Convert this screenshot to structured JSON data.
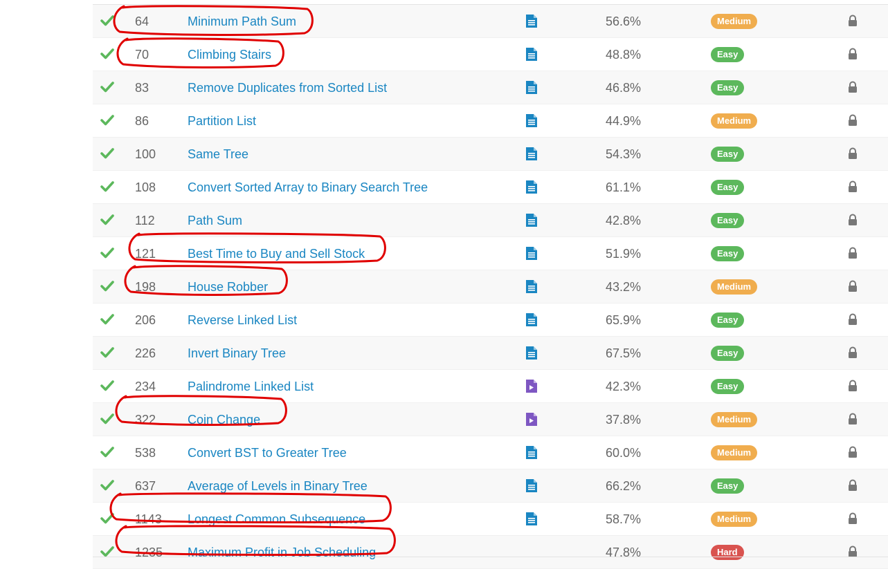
{
  "colors": {
    "title_link": "#1a86c2",
    "check": "#5cb85c",
    "easy": "#5cb85c",
    "medium": "#f0ad4e",
    "hard": "#d9534f",
    "solution_article": "#1a86c2",
    "solution_video": "#7e57c2",
    "annotation": "#e00000"
  },
  "icons": {
    "status": "check-icon",
    "solution_article": "document-icon",
    "solution_video": "video-document-icon",
    "premium": "lock-icon"
  },
  "problems": [
    {
      "id": "64",
      "title": "Minimum Path Sum",
      "solution": "article",
      "acceptance": "56.6%",
      "difficulty": "Medium",
      "circled": true
    },
    {
      "id": "70",
      "title": "Climbing Stairs",
      "solution": "article",
      "acceptance": "48.8%",
      "difficulty": "Easy",
      "circled": true
    },
    {
      "id": "83",
      "title": "Remove Duplicates from Sorted List",
      "solution": "article",
      "acceptance": "46.8%",
      "difficulty": "Easy",
      "circled": false
    },
    {
      "id": "86",
      "title": "Partition List",
      "solution": "article",
      "acceptance": "44.9%",
      "difficulty": "Medium",
      "circled": false
    },
    {
      "id": "100",
      "title": "Same Tree",
      "solution": "article",
      "acceptance": "54.3%",
      "difficulty": "Easy",
      "circled": false
    },
    {
      "id": "108",
      "title": "Convert Sorted Array to Binary Search Tree",
      "solution": "article",
      "acceptance": "61.1%",
      "difficulty": "Easy",
      "circled": false
    },
    {
      "id": "112",
      "title": "Path Sum",
      "solution": "article",
      "acceptance": "42.8%",
      "difficulty": "Easy",
      "circled": false
    },
    {
      "id": "121",
      "title": "Best Time to Buy and Sell Stock",
      "solution": "article",
      "acceptance": "51.9%",
      "difficulty": "Easy",
      "circled": true
    },
    {
      "id": "198",
      "title": "House Robber",
      "solution": "article",
      "acceptance": "43.2%",
      "difficulty": "Medium",
      "circled": true
    },
    {
      "id": "206",
      "title": "Reverse Linked List",
      "solution": "article",
      "acceptance": "65.9%",
      "difficulty": "Easy",
      "circled": false
    },
    {
      "id": "226",
      "title": "Invert Binary Tree",
      "solution": "article",
      "acceptance": "67.5%",
      "difficulty": "Easy",
      "circled": false
    },
    {
      "id": "234",
      "title": "Palindrome Linked List",
      "solution": "video",
      "acceptance": "42.3%",
      "difficulty": "Easy",
      "circled": false
    },
    {
      "id": "322",
      "title": "Coin Change",
      "solution": "video",
      "acceptance": "37.8%",
      "difficulty": "Medium",
      "circled": true
    },
    {
      "id": "538",
      "title": "Convert BST to Greater Tree",
      "solution": "article",
      "acceptance": "60.0%",
      "difficulty": "Medium",
      "circled": false
    },
    {
      "id": "637",
      "title": "Average of Levels in Binary Tree",
      "solution": "article",
      "acceptance": "66.2%",
      "difficulty": "Easy",
      "circled": false
    },
    {
      "id": "1143",
      "title": "Longest Common Subsequence",
      "solution": "article",
      "acceptance": "58.7%",
      "difficulty": "Medium",
      "circled": true
    },
    {
      "id": "1235",
      "title": "Maximum Profit in Job Scheduling",
      "solution": "none",
      "acceptance": "47.8%",
      "difficulty": "Hard",
      "circled": true
    }
  ]
}
